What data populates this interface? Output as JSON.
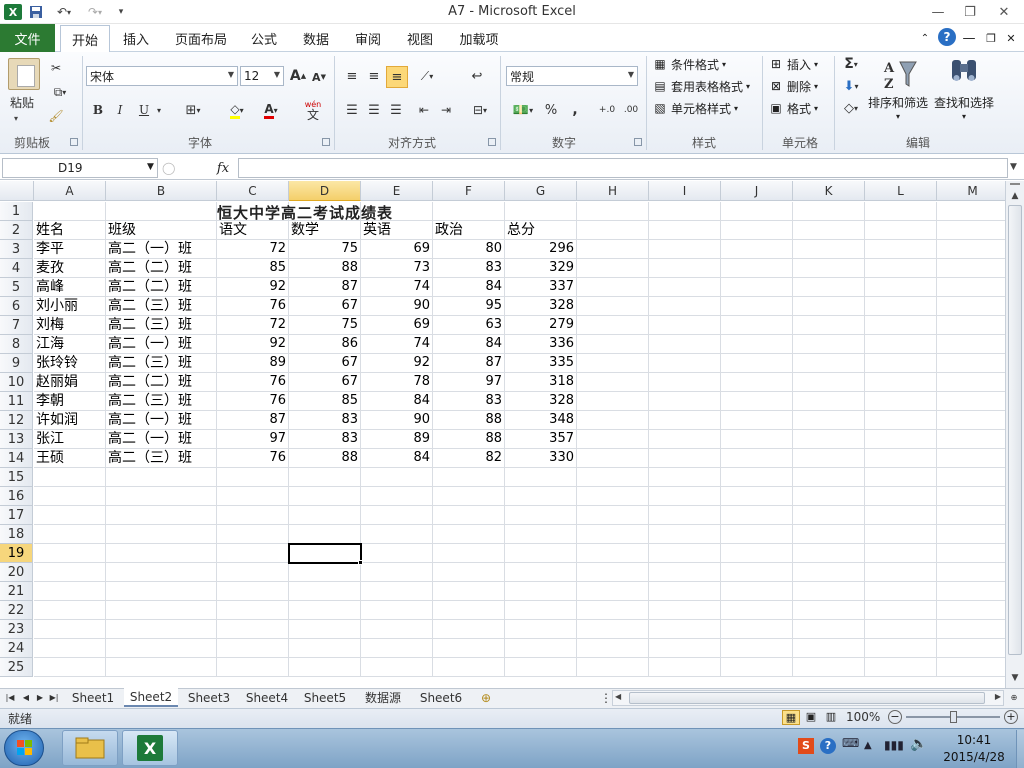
{
  "window": {
    "title": "A7  -  Microsoft Excel"
  },
  "quick_access": {
    "save_icon": "save-icon",
    "undo_icon": "undo-icon",
    "redo_icon": "redo-icon",
    "customize_icon": "chevron-down-icon"
  },
  "tabs": [
    "文件",
    "开始",
    "插入",
    "页面布局",
    "公式",
    "数据",
    "审阅",
    "视图",
    "加载项"
  ],
  "active_tab": "开始",
  "ribbon": {
    "clipboard": {
      "label": "剪贴板",
      "paste": "粘贴"
    },
    "font": {
      "label": "字体",
      "name": "宋体",
      "size": "12",
      "bold": "B",
      "italic": "I",
      "underline": "U",
      "grow": "A",
      "shrink": "A",
      "color_letter": "A",
      "wen": "wén",
      "wen2": "文"
    },
    "alignment": {
      "label": "对齐方式"
    },
    "number": {
      "label": "数字",
      "format": "常规",
      "percent": "%",
      "comma": ",",
      "inc": "+.0",
      "dec": ".00"
    },
    "styles": {
      "label": "样式",
      "cond": "条件格式",
      "table": "套用表格格式",
      "cell": "单元格样式"
    },
    "cells": {
      "label": "单元格",
      "insert": "插入",
      "delete": "删除",
      "format": "格式"
    },
    "editing": {
      "label": "编辑",
      "sigma": "Σ",
      "sort": "排序和筛选",
      "find": "查找和选择"
    }
  },
  "name_box": "D19",
  "fx": "fx",
  "columns": [
    "A",
    "B",
    "C",
    "D",
    "E",
    "F",
    "G",
    "H",
    "I",
    "J",
    "K",
    "L",
    "M"
  ],
  "selected_column": "D",
  "selected_row": 19,
  "sheet": {
    "title": "恒大中学高二考试成绩表",
    "headers": [
      "姓名",
      "班级",
      "语文",
      "数学",
      "英语",
      "政治",
      "总分"
    ],
    "rows": [
      [
        "李平",
        "高二（一）班",
        "72",
        "75",
        "69",
        "80",
        "296"
      ],
      [
        "麦孜",
        "高二（二）班",
        "85",
        "88",
        "73",
        "83",
        "329"
      ],
      [
        "高峰",
        "高二（二）班",
        "92",
        "87",
        "74",
        "84",
        "337"
      ],
      [
        "刘小丽",
        "高二（三）班",
        "76",
        "67",
        "90",
        "95",
        "328"
      ],
      [
        "刘梅",
        "高二（三）班",
        "72",
        "75",
        "69",
        "63",
        "279"
      ],
      [
        "江海",
        "高二（一）班",
        "92",
        "86",
        "74",
        "84",
        "336"
      ],
      [
        "张玲铃",
        "高二（三）班",
        "89",
        "67",
        "92",
        "87",
        "335"
      ],
      [
        "赵丽娟",
        "高二（二）班",
        "76",
        "67",
        "78",
        "97",
        "318"
      ],
      [
        "李朝",
        "高二（三）班",
        "76",
        "85",
        "84",
        "83",
        "328"
      ],
      [
        "许如润",
        "高二（一）班",
        "87",
        "83",
        "90",
        "88",
        "348"
      ],
      [
        "张江",
        "高二（一）班",
        "97",
        "83",
        "89",
        "88",
        "357"
      ],
      [
        "王硕",
        "高二（三）班",
        "76",
        "88",
        "84",
        "82",
        "330"
      ]
    ]
  },
  "sheet_tabs": [
    "Sheet1",
    "Sheet2",
    "Sheet3",
    "Sheet4",
    "Sheet5",
    "数据源",
    "Sheet6"
  ],
  "active_sheet": "Sheet2",
  "status": {
    "ready": "就绪",
    "zoom": "100%"
  },
  "taskbar": {
    "time": "10:41",
    "date": "2015/4/28"
  },
  "colors": {
    "file_tab": "#2c7a32",
    "selection_header": "#f6d67c"
  }
}
